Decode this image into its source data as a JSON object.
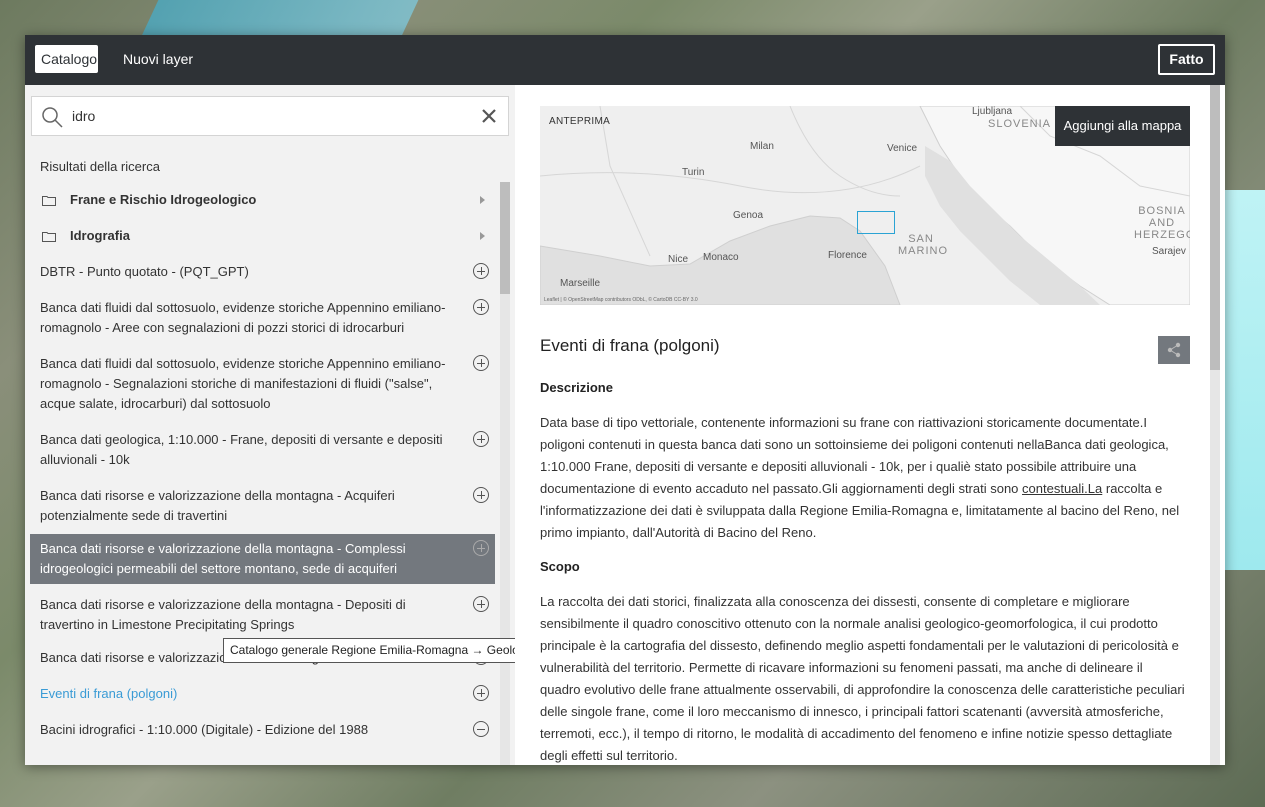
{
  "topbar": {
    "tab_catalog": "Catalogo",
    "tab_new_layers": "Nuovi layer",
    "done_label": "Fatto"
  },
  "search": {
    "value": "idro"
  },
  "results": {
    "header": "Risultati della ricerca",
    "folders": [
      {
        "label": "Frane e Rischio Idrogeologico"
      },
      {
        "label": "Idrografia"
      }
    ],
    "items": [
      {
        "label": "DBTR - Punto quotato - (PQT_GPT)",
        "action": "add"
      },
      {
        "label": "Banca dati fluidi dal sottosuolo, evidenze storiche Appennino emiliano-romagnolo - Aree con segnalazioni di pozzi storici di idrocarburi",
        "action": "add"
      },
      {
        "label": "Banca dati fluidi dal sottosuolo, evidenze storiche Appennino emiliano-romagnolo - Segnalazioni storiche di manifestazioni di fluidi (\"salse\", acque salate, idrocarburi) dal sottosuolo",
        "action": "add"
      },
      {
        "label": "Banca dati geologica, 1:10.000 - Frane, depositi di versante e depositi alluvionali - 10k",
        "action": "add"
      },
      {
        "label": "Banca dati risorse e valorizzazione della montagna - Acquiferi potenzialmente sede di travertini",
        "action": "add"
      },
      {
        "label": "Banca dati risorse e valorizzazione della montagna - Complessi idrogeologici permeabili del settore montano, sede di acquiferi",
        "action": "add"
      },
      {
        "label": "Banca dati risorse e valorizzazione della montagna - Depositi di travertino in Limestone Precipitating Springs",
        "action": "add"
      },
      {
        "label": "Banca dati risorse e valorizzazione della montagna - Strutture tettoniche",
        "action": "add"
      },
      {
        "label": "Eventi di frana (polgoni)",
        "action": "add"
      },
      {
        "label": "Bacini idrografici - 1:10.000 (Digitale) - Edizione del 1988",
        "action": "remove"
      }
    ],
    "tooltip": "Catalogo generale Regione Emilia-Romagna → Geologia"
  },
  "preview": {
    "label": "ANTEPRIMA",
    "add_button": "Aggiungi alla mappa",
    "attribution": "Leaflet | © OpenStreetMap contributors ODbL, © CartoDB CC-BY 3.0",
    "cities": [
      "Ljubljana",
      "Milan",
      "Venice",
      "Turin",
      "Genoa",
      "Florence",
      "Nice",
      "Monaco",
      "Marseille",
      "Sarajev"
    ],
    "countries": [
      "SLOVENIA",
      "BOSNIA AND HERZEGOV",
      "SAN MARINO"
    ]
  },
  "detail": {
    "title": "Eventi di frana (polgoni)",
    "description_heading": "Descrizione",
    "description_1": "Data base di tipo vettoriale, contenente informazioni su frane con riattivazioni storicamente documentate.I poligoni contenuti in questa banca dati sono un sottoinsieme dei poligoni contenuti nellaBanca dati geologica, 1:10.000 Frane, depositi di versante e depositi alluvionali - 10k, per i qualiè stato possibile attribuire una documentazione di evento accaduto nel passato.Gli aggiornamenti degli strati sono ",
    "description_link": "contestuali.La",
    "description_2": " raccolta e l'informatizzazione dei dati è sviluppata dalla Regione Emilia-Romagna e, limitatamente al bacino del Reno, nel primo impianto, dall'Autorità di Bacino del Reno.",
    "scope_heading": "Scopo",
    "scope_text": "La raccolta dei dati storici, finalizzata alla conoscenza dei dissesti, consente di completare e migliorare sensibilmente il quadro conoscitivo ottenuto con la normale analisi geologico-geomorfologica, il cui prodotto principale è la cartografia del dissesto, definendo meglio aspetti fondamentali per le valutazioni di pericolosità e vulnerabilità del territorio. Permette di ricavare informazioni su fenomeni passati, ma anche di delineare il quadro evolutivo delle frane attualmente osservabili, di approfondire la conoscenza delle caratteristiche peculiari delle singole frane, come il loro meccanismo di innesco, i principali fattori scatenanti (avversità atmosferiche, terremoti, ecc.), il tempo di ritorno, le modalità di accadimento del fenomeno e infine notizie spesso dettagliate degli effetti sul territorio."
  }
}
